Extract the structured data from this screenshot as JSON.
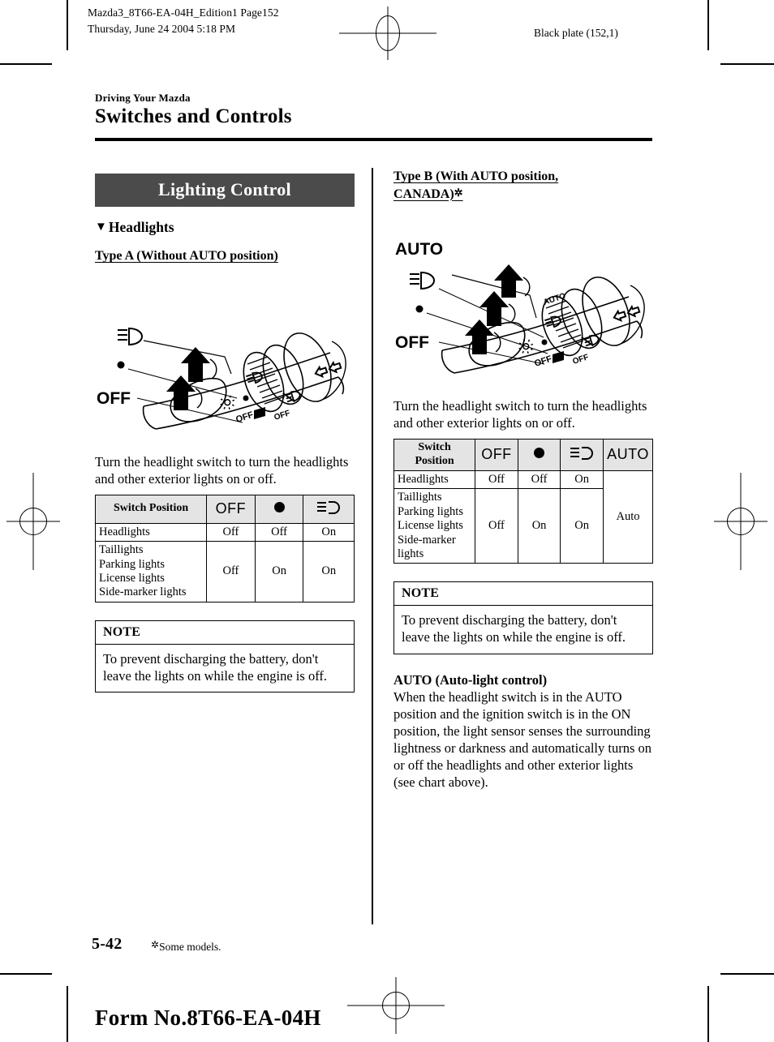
{
  "header": {
    "file_line1": "Mazda3_8T66-EA-04H_Edition1 Page152",
    "file_line2": "Thursday, June 24 2004 5:18 PM",
    "plate": "Black plate (152,1)"
  },
  "document": {
    "kicker": "Driving Your Mazda",
    "section_title": "Switches and Controls"
  },
  "left_column": {
    "banner": "Lighting Control",
    "subhead_marker": "▼",
    "subhead": "Headlights",
    "type_heading": "Type A (Without AUTO position)",
    "illustration_labels": {
      "lowbeam": "lowbeam-icon",
      "dot": "parking-position-dot",
      "off": "OFF",
      "fog": "fog-light-icon",
      "turn": "turn-signal-icon",
      "dial_off": "OFF",
      "dial_lowbeam": "lowbeam-icon",
      "dial_park": "OFF"
    },
    "intro_paragraph": "Turn the headlight switch to turn the headlights and other exterior lights on or off.",
    "table": {
      "headers": [
        "Switch Position",
        "OFF",
        "dot-icon",
        "lowbeam-icon"
      ],
      "rows": [
        {
          "label": "Headlights",
          "values": [
            "Off",
            "Off",
            "On"
          ]
        },
        {
          "label": "Taillights\nParking lights\nLicense lights\nSide-marker lights",
          "values": [
            "Off",
            "On",
            "On"
          ]
        }
      ]
    },
    "note": {
      "title": "NOTE",
      "body": "To prevent discharging the battery, don't leave the lights on while the engine is off."
    }
  },
  "right_column": {
    "type_heading_line1": "Type B (With AUTO position,",
    "type_heading_line2": "CANADA)",
    "type_heading_star": "✲",
    "illustration_labels": {
      "auto": "AUTO",
      "lowbeam": "lowbeam-icon",
      "dot": "parking-position-dot",
      "off": "OFF"
    },
    "intro_paragraph": "Turn the headlight switch to turn the headlights and other exterior lights on or off.",
    "table": {
      "headers": [
        "Switch Position",
        "OFF",
        "dot-icon",
        "lowbeam-icon",
        "AUTO"
      ],
      "rows": [
        {
          "label": "Headlights",
          "values": [
            "Off",
            "Off",
            "On"
          ]
        },
        {
          "label": "Taillights\nParking lights\nLicense lights\nSide-marker\nlights",
          "values": [
            "Off",
            "On",
            "On"
          ]
        }
      ],
      "auto_cell": "Auto"
    },
    "note": {
      "title": "NOTE",
      "body": "To prevent discharging the battery, don't leave the lights on while the engine is off."
    },
    "auto_section": {
      "title": "AUTO (Auto-light control)",
      "body": "When the headlight switch is in the AUTO position and the ignition switch is in the ON position, the light sensor senses the surrounding lightness or darkness and automatically turns on or off the headlights and other exterior lights (see chart above)."
    }
  },
  "footer": {
    "page_number": "5-42",
    "footnote_star": "✲",
    "footnote": "Some models.",
    "form_no": "Form No.8T66-EA-04H"
  },
  "colors": {
    "banner_bg": "#4b4b4b",
    "banner_text": "#ffffff",
    "table_header_bg": "#e4e4e4",
    "rule": "#000000"
  }
}
